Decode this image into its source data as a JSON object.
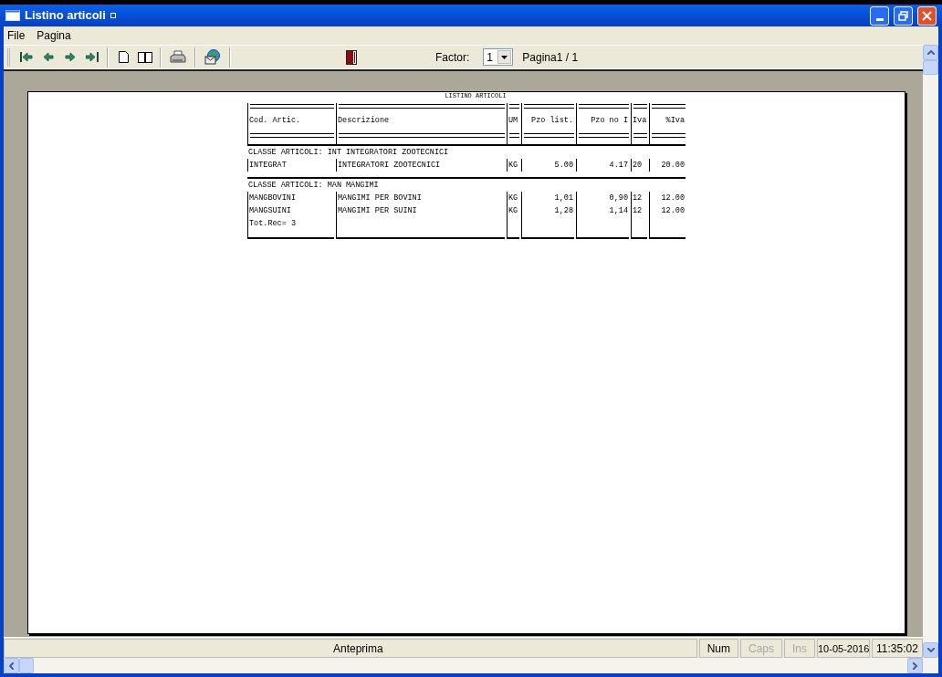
{
  "window": {
    "title": "Listino articoli"
  },
  "menu": [
    "File",
    "Pagina"
  ],
  "toolbar": {
    "factor_label": "Factor:",
    "factor_value": "1",
    "page_label": "Pagina1 / 1"
  },
  "report": {
    "title": "LISTINO ARTICOLI",
    "columns": [
      "Cod. Artic.",
      "Descrizione",
      "UM",
      "Pzo list.",
      "Pzo no I",
      "Iva",
      "%Iva"
    ],
    "groups": [
      {
        "code": "CLASSE ARTICOLI: INT",
        "description": "INTEGRATORI ZOOTECNICI",
        "rows": [
          {
            "cells": [
              "INTEGRAT",
              "INTEGRATORI ZOOTECNICI",
              "KG",
              "5.00",
              "4.17",
              "20",
              "20.00"
            ]
          }
        ]
      },
      {
        "code": "CLASSE ARTICOLI: MAN",
        "description": "MANGIMI",
        "rows": [
          {
            "cells": [
              "MANGBOVINI",
              "MANGIMI PER BOVINI",
              "KG",
              "1,01",
              "0,90",
              "12",
              "12.00"
            ]
          },
          {
            "cells": [
              "MANGSUINI",
              "MANGIMI PER SUINI",
              "KG",
              "1,28",
              "1,14",
              "12",
              "12.00"
            ]
          }
        ]
      }
    ],
    "total": "Tot.Rec= 3"
  },
  "status_bar": {
    "message": "Anteprima",
    "indicators": [
      {
        "label": "Num",
        "on": true
      },
      {
        "label": "Caps",
        "on": false
      },
      {
        "label": "Ins",
        "on": false
      }
    ],
    "date": "10-05-2016",
    "time": "11:35:02"
  }
}
